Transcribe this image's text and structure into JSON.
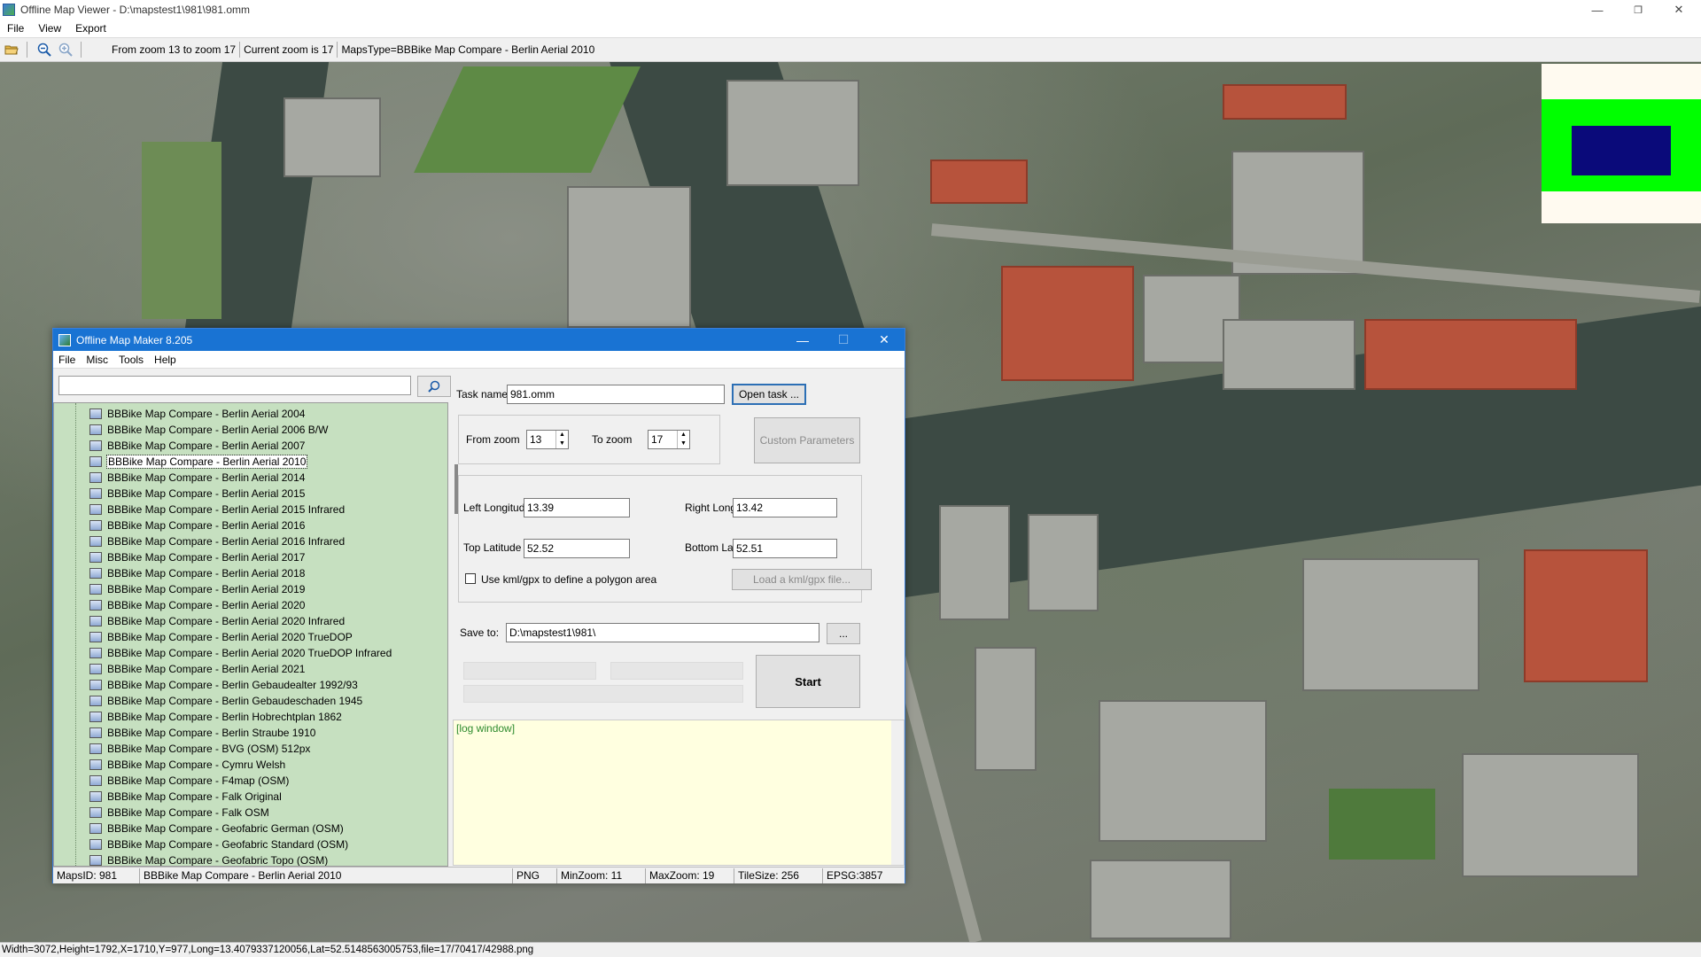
{
  "window": {
    "title": "Offline Map Viewer - D:\\mapstest1\\981\\981.omm",
    "menu": [
      "File",
      "View",
      "Export"
    ],
    "controls": {
      "minimize": "—",
      "restore": "❐",
      "close": "✕"
    }
  },
  "toolbar": {
    "zoom_range": "From zoom 13 to zoom 17",
    "current_zoom": "Current zoom is 17",
    "maps_type": "MapsType=BBBike Map Compare - Berlin Aerial 2010"
  },
  "status_bar": "Width=3072,Height=1792,X=1710,Y=977,Long=13.4079337120056,Lat=52.5148563005753,file=17/70417/42988.png",
  "dialog": {
    "title": "Offline Map Maker 8.205",
    "menu": [
      "File",
      "Misc",
      "Tools",
      "Help"
    ],
    "search": {
      "value": "",
      "placeholder": ""
    },
    "tree_items": [
      "BBBike Map Compare - Berlin Aerial 2004",
      "BBBike Map Compare - Berlin Aerial 2006 B/W",
      "BBBike Map Compare - Berlin Aerial 2007",
      "BBBike Map Compare - Berlin Aerial 2010",
      "BBBike Map Compare - Berlin Aerial 2014",
      "BBBike Map Compare - Berlin Aerial 2015",
      "BBBike Map Compare - Berlin Aerial 2015 Infrared",
      "BBBike Map Compare - Berlin Aerial 2016",
      "BBBike Map Compare - Berlin Aerial 2016 Infrared",
      "BBBike Map Compare - Berlin Aerial 2017",
      "BBBike Map Compare - Berlin Aerial 2018",
      "BBBike Map Compare - Berlin Aerial 2019",
      "BBBike Map Compare - Berlin Aerial 2020",
      "BBBike Map Compare - Berlin Aerial 2020 Infrared",
      "BBBike Map Compare - Berlin Aerial 2020 TrueDOP",
      "BBBike Map Compare - Berlin Aerial 2020 TrueDOP Infrared",
      "BBBike Map Compare - Berlin Aerial 2021",
      "BBBike Map Compare - Berlin Gebaudealter 1992/93",
      "BBBike Map Compare - Berlin Gebaudeschaden 1945",
      "BBBike Map Compare - Berlin Hobrechtplan 1862",
      "BBBike Map Compare - Berlin Straube 1910",
      "BBBike Map Compare - BVG (OSM) 512px",
      "BBBike Map Compare - Cymru Welsh",
      "BBBike Map Compare - F4map (OSM)",
      "BBBike Map Compare - Falk Original",
      "BBBike Map Compare - Falk OSM",
      "BBBike Map Compare - Geofabric German (OSM)",
      "BBBike Map Compare - Geofabric Standard (OSM)",
      "BBBike Map Compare - Geofabric Topo (OSM)"
    ],
    "selected_index": 3,
    "task_name_label": "Task name",
    "task_name_value": "981.omm",
    "open_task_button": "Open task ...",
    "from_zoom_label": "From zoom",
    "from_zoom_value": "13",
    "to_zoom_label": "To zoom",
    "to_zoom_value": "17",
    "custom_parameters_button": "Custom Parameters",
    "left_longitude_label": "Left Longitude",
    "left_longitude_value": "13.39",
    "right_longitude_label": "Right Longitude",
    "right_longitude_value": "13.42",
    "top_latitude_label": "Top Latitude",
    "top_latitude_value": "52.52",
    "bottom_latitude_label": "Bottom Latitude",
    "bottom_latitude_value": "52.51",
    "kml_checkbox_label": "Use kml/gpx to define a polygon area",
    "kml_checked": false,
    "load_kml_button": "Load a kml/gpx file...",
    "save_to_label": "Save to:",
    "save_to_value": "D:\\mapstest1\\981\\",
    "browse_button": "...",
    "start_button": "Start",
    "log_text": "[log window]",
    "status": {
      "maps_id": "MapsID: 981",
      "map_name": "BBBike Map Compare - Berlin Aerial 2010",
      "format": "PNG",
      "min_zoom": "MinZoom: 11",
      "max_zoom": "MaxZoom: 19",
      "tile_size": "TileSize: 256",
      "epsg": "EPSG:3857"
    }
  },
  "overview_colors": {
    "background": "#fffaf0",
    "frame": "#00ff00",
    "viewport": "#0a0a7a"
  }
}
